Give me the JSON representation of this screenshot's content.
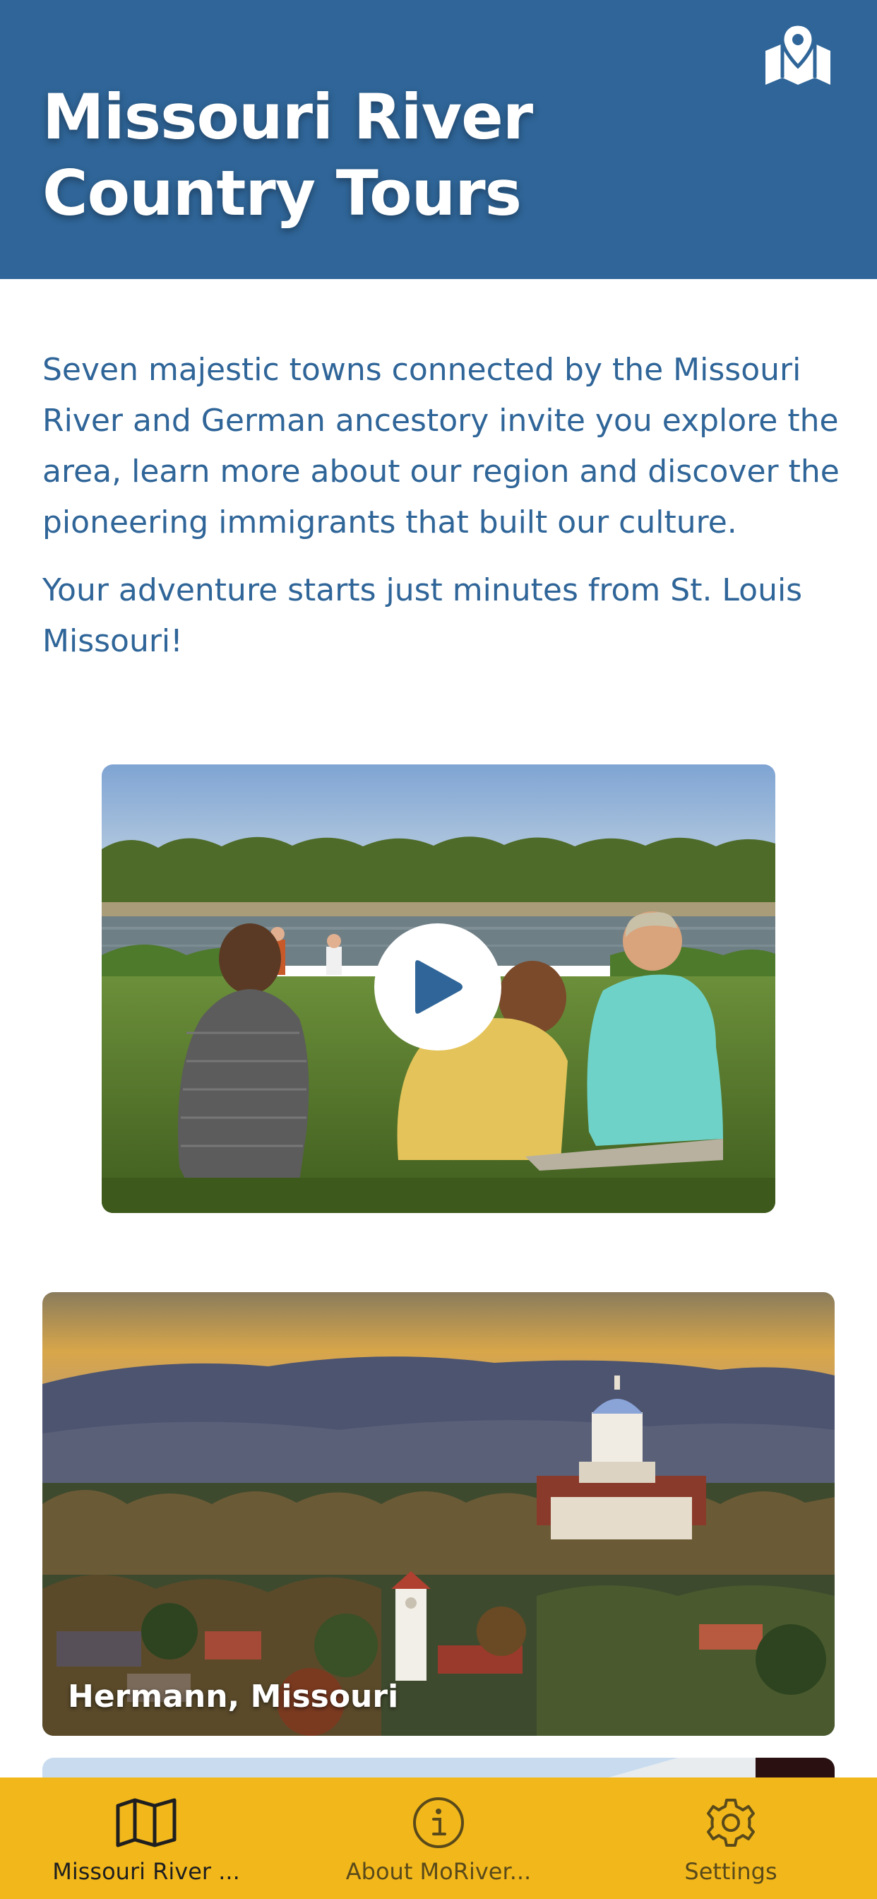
{
  "header": {
    "title": "Missouri River Country Tours",
    "map_icon": "map-pin-icon"
  },
  "intro": {
    "paragraph1": "Seven majestic towns connected by the Missouri River and German ancestory invite you explore the area, learn more about our region and discover the pioneering immigrants that built our culture.",
    "paragraph2": "Your adventure starts just minutes from St. Louis Missouri!"
  },
  "video": {
    "play_icon": "play-icon"
  },
  "towns": [
    {
      "name": "Hermann, Missouri"
    }
  ],
  "tabbar": {
    "items": [
      {
        "label": "Missouri River ...",
        "icon": "map-icon",
        "active": true
      },
      {
        "label": "About MoRiver...",
        "icon": "info-icon",
        "active": false
      },
      {
        "label": "Settings",
        "icon": "gear-icon",
        "active": false
      }
    ]
  },
  "colors": {
    "header_bg": "#2f6598",
    "text_blue": "#2f6598",
    "tabbar_bg": "#f2b81b",
    "tab_active": "#1f1f1f",
    "tab_inactive": "#5a4a1a"
  }
}
